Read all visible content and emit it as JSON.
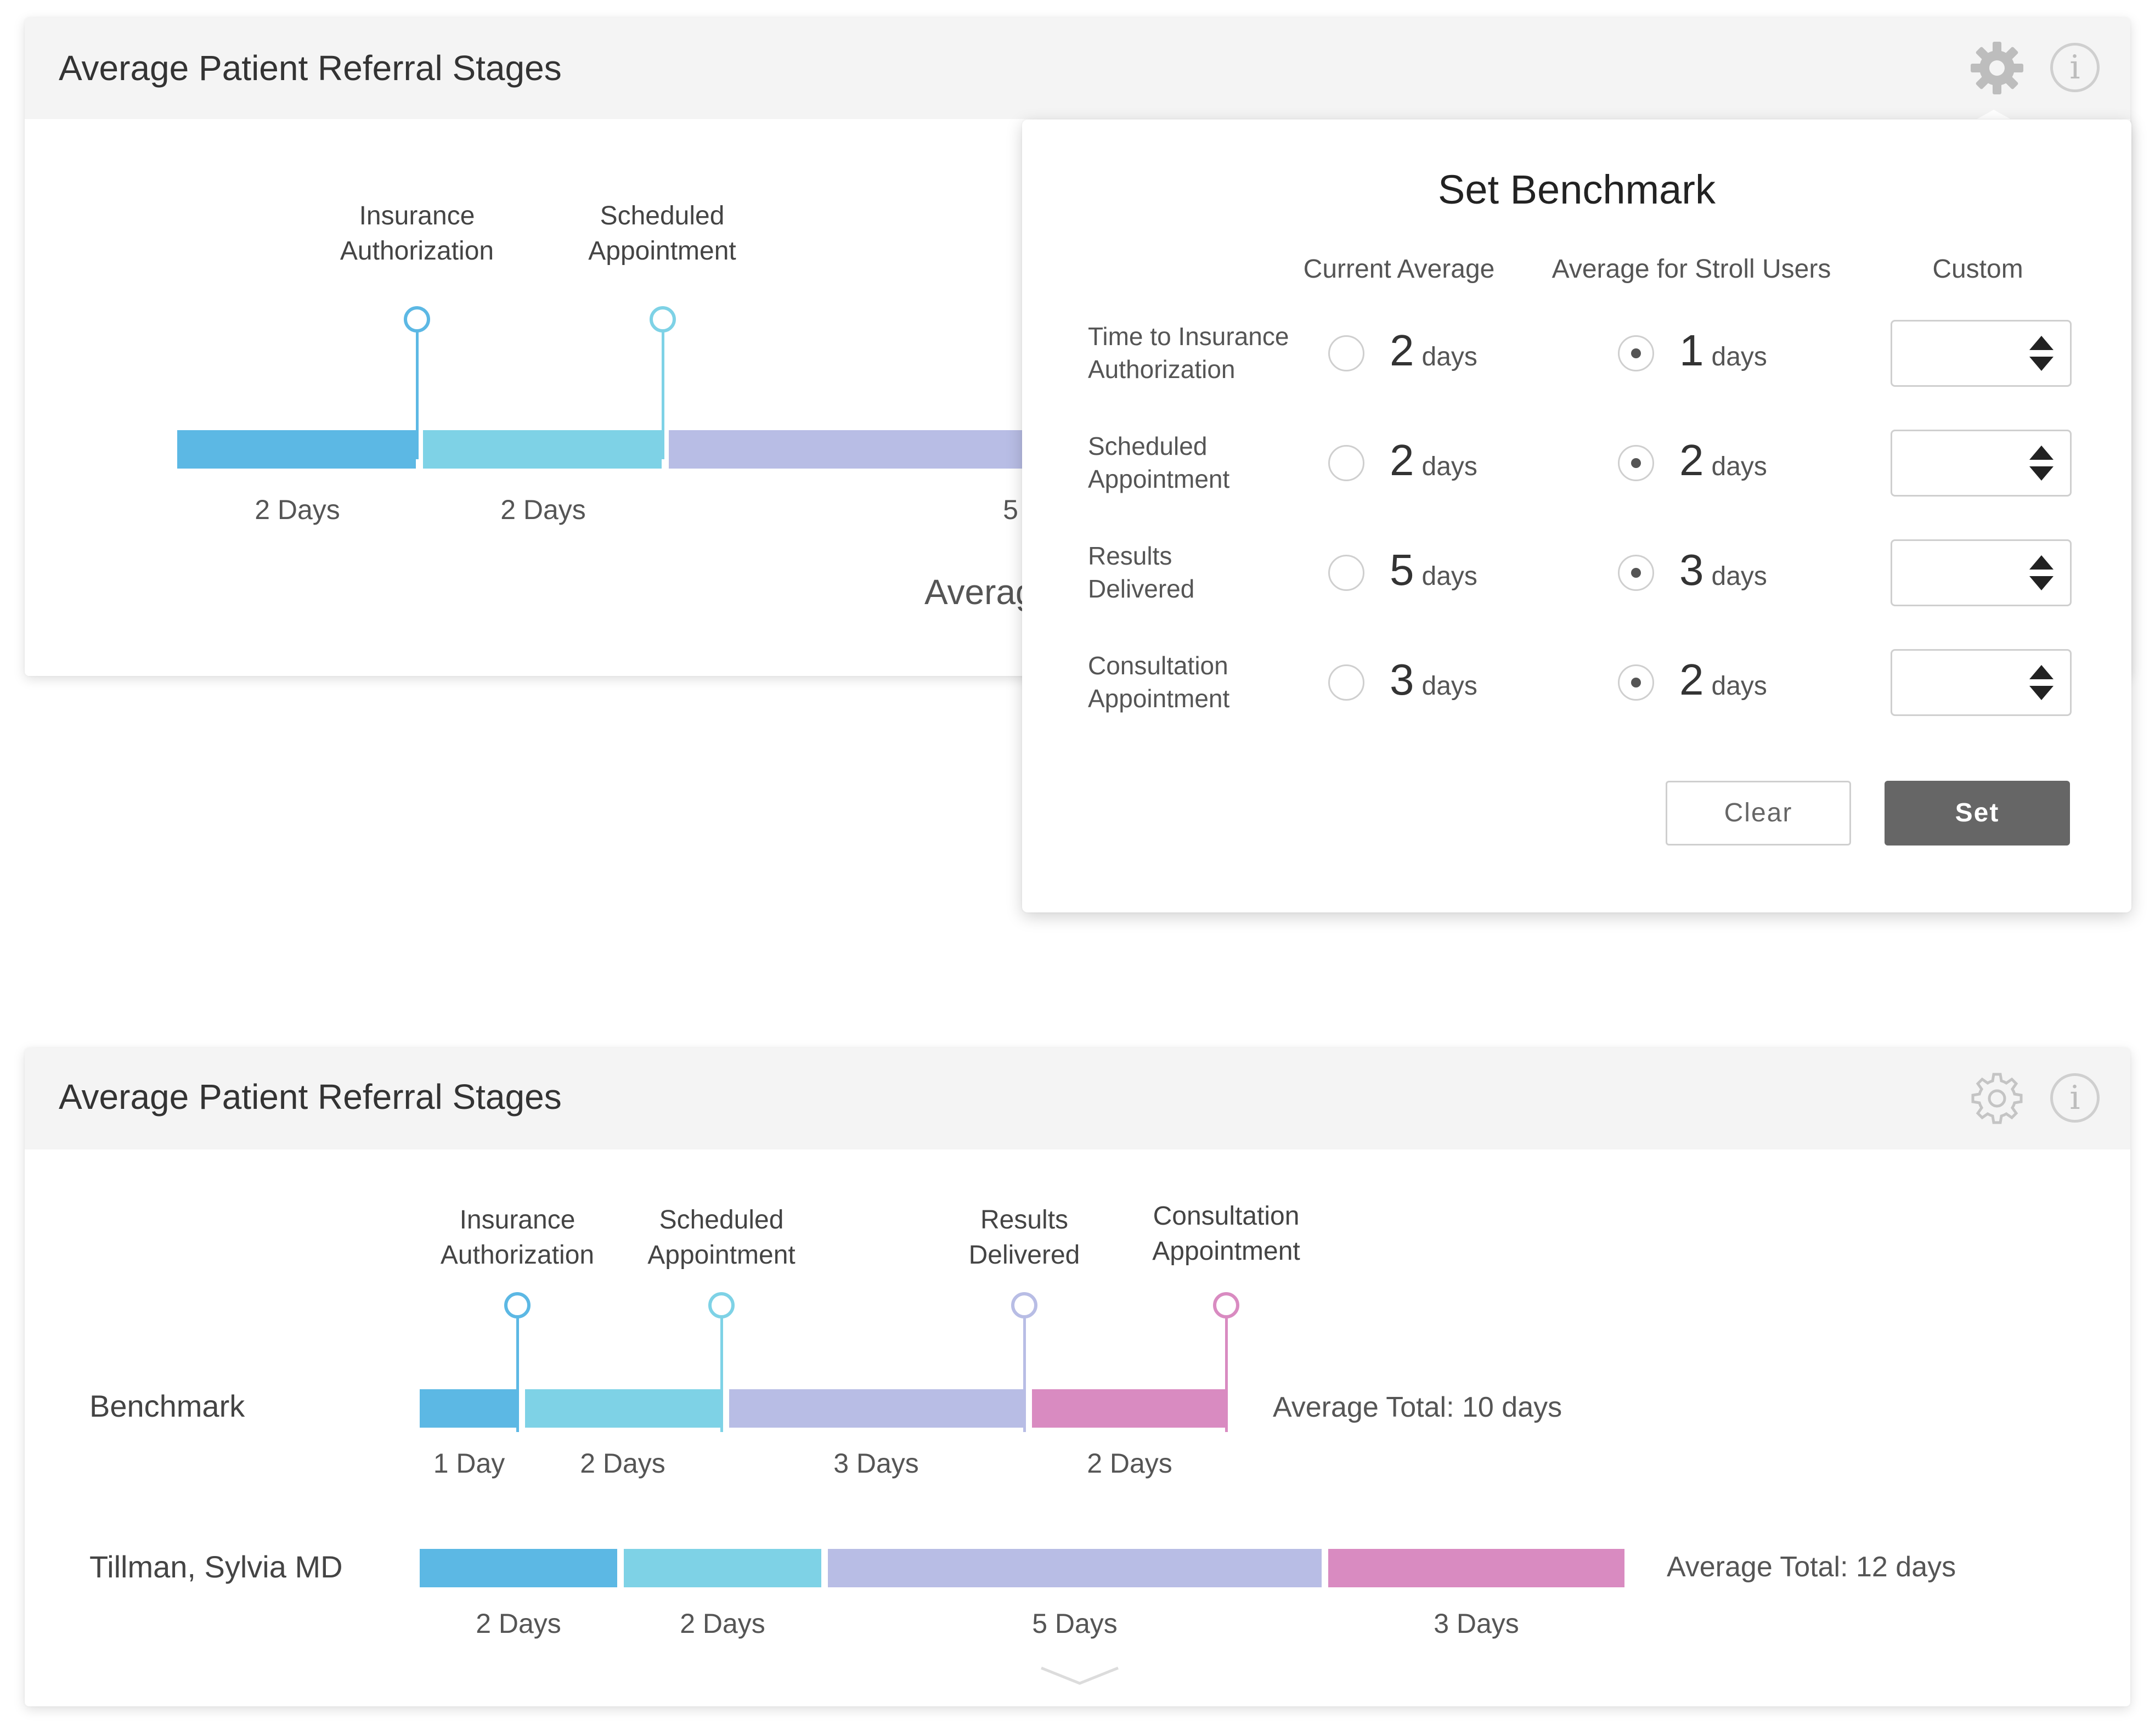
{
  "top_card": {
    "title": "Average Patient Referral Stages",
    "stage_labels": [
      "Insurance\nAuthorization",
      "Scheduled\nAppointment"
    ],
    "durations": [
      "2 Days",
      "2 Days",
      "5"
    ],
    "average_text_partial": "Averag"
  },
  "popover": {
    "title": "Set Benchmark",
    "columns": [
      "Current Average",
      "Average for Stroll Users",
      "Custom"
    ],
    "rows": [
      {
        "label": "Time to Insurance\nAuthorization",
        "current": "2",
        "stroll": "1",
        "unit": "days",
        "selected": "stroll"
      },
      {
        "label": "Scheduled\nAppointment",
        "current": "2",
        "stroll": "2",
        "unit": "days",
        "selected": "stroll"
      },
      {
        "label": "Results\nDelivered",
        "current": "5",
        "stroll": "3",
        "unit": "days",
        "selected": "stroll"
      },
      {
        "label": "Consultation\nAppointment",
        "current": "3",
        "stroll": "2",
        "unit": "days",
        "selected": "stroll"
      }
    ],
    "clear_label": "Clear",
    "set_label": "Set"
  },
  "bottom_card": {
    "title": "Average Patient Referral Stages",
    "stage_labels": [
      "Insurance\nAuthorization",
      "Scheduled\nAppointment",
      "Results\nDelivered",
      "Consultation\nAppointment"
    ],
    "rows": [
      {
        "name": "Benchmark",
        "durations": [
          "1 Day",
          "2 Days",
          "3 Days",
          "2 Days"
        ],
        "total": "Average Total: 10 days"
      },
      {
        "name": "Tillman, Sylvia MD",
        "durations": [
          "2 Days",
          "2 Days",
          "5 Days",
          "3 Days"
        ],
        "total": "Average Total: 12 days"
      }
    ]
  },
  "stage_colors": [
    "#5cb8e4",
    "#7ed2e6",
    "#b8bde5",
    "#d98bc1"
  ],
  "icons": [
    "gear-icon",
    "info-icon",
    "chevron-down-icon"
  ]
}
